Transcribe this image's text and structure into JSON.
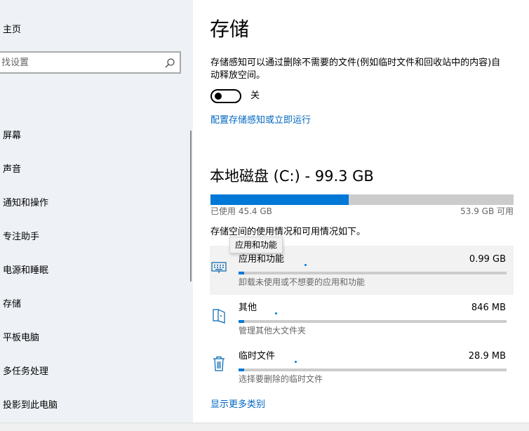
{
  "nav": {
    "home_label": "主页",
    "search_placeholder": "找设置",
    "items": [
      "屏幕",
      "声音",
      "通知和操作",
      "专注助手",
      "电源和睡眠",
      "存储",
      "平板电脑",
      "多任务处理",
      "投影到此电脑"
    ]
  },
  "page": {
    "title": "存储",
    "description": "存储感知可以通过删除不需要的文件(例如临时文件和回收站中的内容)自动释放空间。",
    "toggle_state": "关",
    "toggle_on": false,
    "config_link": "配置存储感知或立即运行"
  },
  "drive": {
    "title": "本地磁盘 (C:) - 99.3 GB",
    "used_fraction": 0.457,
    "used_label": "已使用 45.4 GB",
    "free_label": "53.9 GB 可用",
    "caption": "存储空间的使用情况和可用情况如下。"
  },
  "categories": [
    {
      "title": "应用和功能",
      "size": "0.99 GB",
      "subtitle": "卸载未使用或不想要的应用和功能",
      "fill_fraction": 0.02,
      "icon": "keyboard-icon"
    },
    {
      "title": "其他",
      "size": "846 MB",
      "subtitle": "管理其他大文件夹",
      "fill_fraction": 0.02,
      "icon": "folder-icon"
    },
    {
      "title": "临时文件",
      "size": "28.9 MB",
      "subtitle": "选择要删除的临时文件",
      "fill_fraction": 0.02,
      "icon": "trash-icon"
    }
  ],
  "tooltip": "应用和功能",
  "more_link": "显示更多类别",
  "colors": {
    "accent": "#0078d7",
    "link": "#0067c0",
    "track": "#cccccc"
  }
}
